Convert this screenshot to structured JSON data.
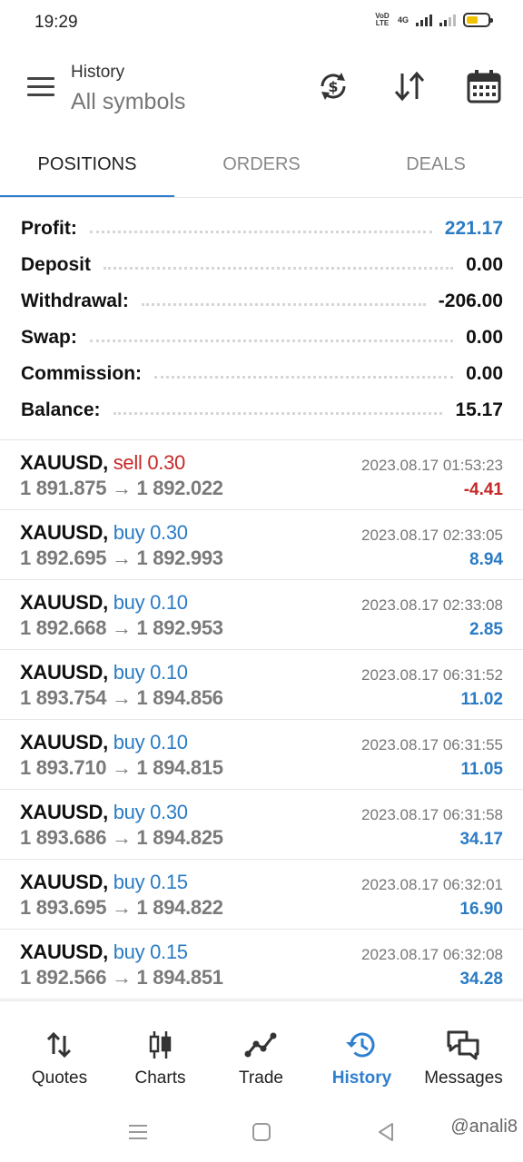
{
  "status_bar": {
    "time": "19:29",
    "volte_label": "VoD LTE",
    "network_label": "4G"
  },
  "header": {
    "subtitle": "History",
    "title": "All symbols",
    "icons": [
      "menu-icon",
      "currency-exchange-icon",
      "sort-icon",
      "calendar-icon"
    ]
  },
  "tabs": [
    {
      "label": "POSITIONS",
      "active": true
    },
    {
      "label": "ORDERS",
      "active": false
    },
    {
      "label": "DEALS",
      "active": false
    }
  ],
  "summary": [
    {
      "label": "Profit:",
      "value": "221.17",
      "highlight": true
    },
    {
      "label": "Deposit",
      "value": "0.00",
      "highlight": false
    },
    {
      "label": "Withdrawal:",
      "value": "-206.00",
      "highlight": false
    },
    {
      "label": "Swap:",
      "value": "0.00",
      "highlight": false
    },
    {
      "label": "Commission:",
      "value": "0.00",
      "highlight": false
    },
    {
      "label": "Balance:",
      "value": "15.17",
      "highlight": false
    }
  ],
  "deals": [
    {
      "symbol": "XAUUSD,",
      "side": "sell 0.30",
      "type": "sell",
      "open": "1 891.875",
      "close": "1 892.022",
      "time": "2023.08.17 01:53:23",
      "profit": "-4.41"
    },
    {
      "symbol": "XAUUSD,",
      "side": "buy 0.30",
      "type": "buy",
      "open": "1 892.695",
      "close": "1 892.993",
      "time": "2023.08.17 02:33:05",
      "profit": "8.94"
    },
    {
      "symbol": "XAUUSD,",
      "side": "buy 0.10",
      "type": "buy",
      "open": "1 892.668",
      "close": "1 892.953",
      "time": "2023.08.17 02:33:08",
      "profit": "2.85"
    },
    {
      "symbol": "XAUUSD,",
      "side": "buy 0.10",
      "type": "buy",
      "open": "1 893.754",
      "close": "1 894.856",
      "time": "2023.08.17 06:31:52",
      "profit": "11.02"
    },
    {
      "symbol": "XAUUSD,",
      "side": "buy 0.10",
      "type": "buy",
      "open": "1 893.710",
      "close": "1 894.815",
      "time": "2023.08.17 06:31:55",
      "profit": "11.05"
    },
    {
      "symbol": "XAUUSD,",
      "side": "buy 0.30",
      "type": "buy",
      "open": "1 893.686",
      "close": "1 894.825",
      "time": "2023.08.17 06:31:58",
      "profit": "34.17"
    },
    {
      "symbol": "XAUUSD,",
      "side": "buy 0.15",
      "type": "buy",
      "open": "1 893.695",
      "close": "1 894.822",
      "time": "2023.08.17 06:32:01",
      "profit": "16.90"
    },
    {
      "symbol": "XAUUSD,",
      "side": "buy 0.15",
      "type": "buy",
      "open": "1 892.566",
      "close": "1 894.851",
      "time": "2023.08.17 06:32:08",
      "profit": "34.28"
    }
  ],
  "bottom_nav": [
    {
      "label": "Quotes",
      "icon": "quotes-icon",
      "active": false
    },
    {
      "label": "Charts",
      "icon": "candlestick-icon",
      "active": false
    },
    {
      "label": "Trade",
      "icon": "trade-line-icon",
      "active": false
    },
    {
      "label": "History",
      "icon": "history-icon",
      "active": true
    },
    {
      "label": "Messages",
      "icon": "messages-icon",
      "active": false
    }
  ],
  "system_nav": {
    "watermark": "@anali8"
  },
  "colors": {
    "accent": "#2f7fd0",
    "profit_positive": "#2a7bc4",
    "profit_negative": "#c62828",
    "sell": "#c62828",
    "buy": "#2a7bc4",
    "battery": "#f2c200"
  }
}
